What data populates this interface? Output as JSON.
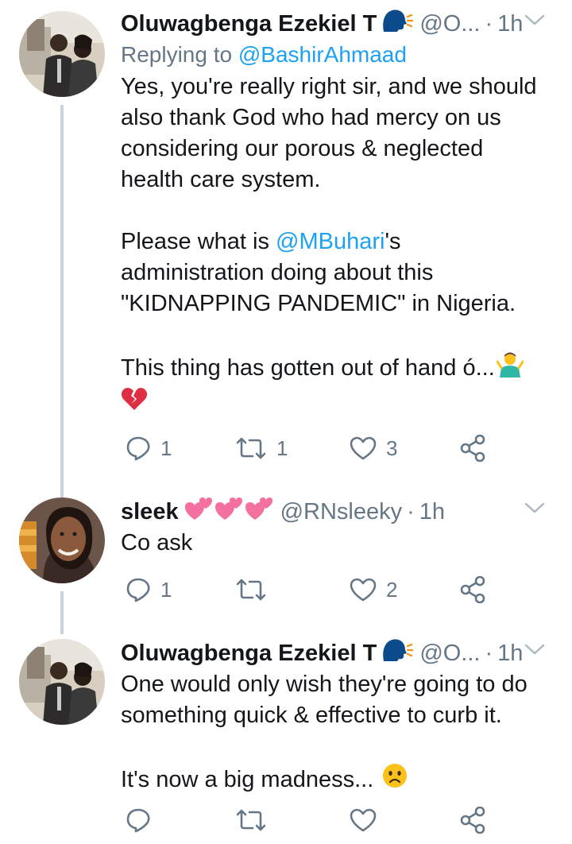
{
  "tweets": [
    {
      "name": "Oluwagbenga Ezekiel T",
      "emoji": "speaking-head",
      "handle": "@O...",
      "dot": "·",
      "time": "1h",
      "replying_prefix": "Replying to ",
      "replying_handle": "@BashirAhmaad",
      "lines": [
        "Yes, you're really right sir, and we should",
        "also thank God who had mercy on us",
        "considering our porous & neglected",
        "health care system.",
        "",
        "Please what is {@MBuhari}'s",
        "administration doing about this",
        "\"KIDNAPPING PANDEMIC\" in Nigeria.",
        "",
        "This thing has gotten out of hand ó..."
      ],
      "mention": "@MBuhari",
      "line5_prefix": "Please what is ",
      "line5_suffix": "'s",
      "replies": "1",
      "retweets": "1",
      "likes": "3"
    },
    {
      "name": "sleek",
      "emojis": [
        "two-hearts",
        "two-hearts",
        "two-hearts"
      ],
      "handle": "@RNsleeky",
      "dot": "·",
      "time": "1h",
      "lines": [
        "Co ask"
      ],
      "replies": "1",
      "retweets": "",
      "likes": "2"
    },
    {
      "name": "Oluwagbenga Ezekiel T",
      "emoji": "speaking-head",
      "handle": "@O...",
      "dot": "·",
      "time": "1h",
      "lines": [
        "One would only wish they're going to do",
        "something quick & effective to curb it.",
        "",
        "It's now a big madness..."
      ],
      "replies": "",
      "retweets": "",
      "likes": ""
    }
  ],
  "colors": {
    "link": "#1da1f2",
    "secondary": "#657786",
    "text": "#14171a",
    "thread_line": "#c9d3da"
  }
}
